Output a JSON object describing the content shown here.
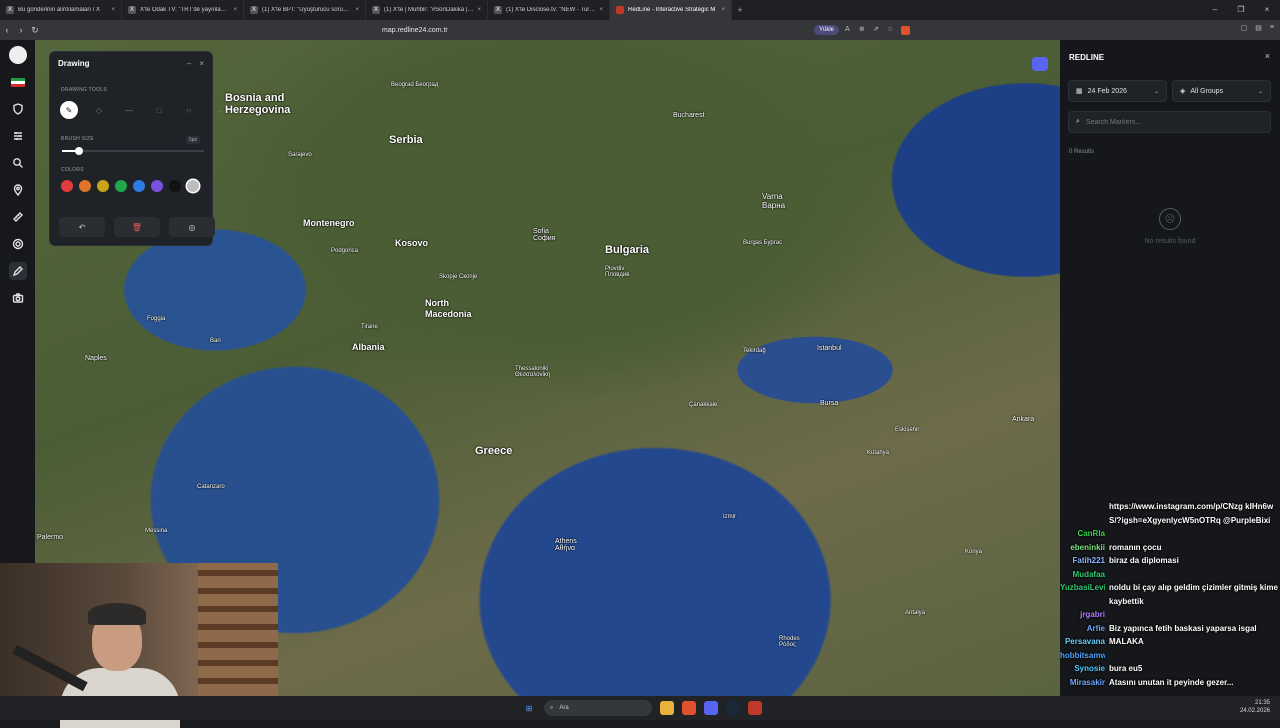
{
  "tabs": [
    {
      "title": "Bu gönderinin alıntılamaları / X",
      "icon": "x-icon",
      "active": false
    },
    {
      "title": "X'te Odak TV: \"TRT'de yayınlanan Bir",
      "icon": "x-icon",
      "active": false
    },
    {
      "title": "(1) X'te BPT: \"Uyuşturucu soruşturmu",
      "icon": "x-icon",
      "active": false
    },
    {
      "title": "(1) X'te | Muhbir: \"#SonDakika | Ur",
      "icon": "x-icon",
      "active": false
    },
    {
      "title": "(1) X'te Disclose.tv: \"NEW - Turkey to",
      "icon": "x-icon",
      "active": false
    },
    {
      "title": "RedLine - Interactive Strategic M",
      "icon": "redline-icon",
      "active": true
    }
  ],
  "address": {
    "url": "map.redline24.com.tr",
    "yukle": "Yükle"
  },
  "drawing": {
    "title": "Drawing",
    "tools_label": "DRAWING TOOLS",
    "brush_label": "BRUSH SIZE",
    "brush_value": "5px",
    "brush_fraction": 0.12,
    "colors_label": "COLORS",
    "colors": [
      "#e23c3c",
      "#e0752a",
      "#c9a41b",
      "#22a64b",
      "#2b7de1",
      "#7b4fe0",
      "#111111",
      "#bdbdbd"
    ]
  },
  "side": {
    "title": "REDLINE",
    "date": "24 Feb 2026",
    "group": "All Groups",
    "search_placeholder": "Search Markers...",
    "results": "0 Results",
    "empty": "No results found"
  },
  "map_labels": [
    {
      "t": "Bosnia and Herzegovina",
      "c": true
    },
    {
      "t": "Serbia",
      "c": true
    },
    {
      "t": "Montenegro",
      "c": true
    },
    {
      "t": "Kosovo",
      "c": true
    },
    {
      "t": "Bulgaria",
      "c": true
    },
    {
      "t": "North Macedonia",
      "c": true
    },
    {
      "t": "Albania",
      "c": true
    },
    {
      "t": "Greece",
      "c": true
    },
    {
      "t": "Sarajevo"
    },
    {
      "t": "Beograd Београд"
    },
    {
      "t": "Bucharest"
    },
    {
      "t": "Sofia София"
    },
    {
      "t": "Varna Варна"
    },
    {
      "t": "Skopje Скопје"
    },
    {
      "t": "Tirane"
    },
    {
      "t": "Thessaloniki Θεσσαλονίκη"
    },
    {
      "t": "Athens Αθήνα"
    },
    {
      "t": "Istanbul"
    },
    {
      "t": "Bursa"
    },
    {
      "t": "Izmir"
    },
    {
      "t": "Ankara"
    },
    {
      "t": "Eskişehir"
    },
    {
      "t": "Konya"
    },
    {
      "t": "Antalya"
    },
    {
      "t": "Naples"
    },
    {
      "t": "Bari"
    },
    {
      "t": "Palermo"
    },
    {
      "t": "Plovdiv Пловдив"
    },
    {
      "t": "Burgas Бургас"
    },
    {
      "t": "Podgorica"
    },
    {
      "t": "Foggia"
    },
    {
      "t": "Catanzaro"
    },
    {
      "t": "Messina"
    },
    {
      "t": "Rhodes Ρόδος"
    },
    {
      "t": "Kütahya"
    },
    {
      "t": "Tekirdağ"
    },
    {
      "t": "Çanakkale"
    }
  ],
  "chat": [
    {
      "name": "",
      "color": "#ffffff",
      "msg": "https://www.instagram.com/p/CNzg kIHn6wS/?igsh=eXgyenlycW5nOTRq @PurpleBixi"
    },
    {
      "name": "CanRla",
      "color": "#39d353",
      "msg": ""
    },
    {
      "name": "ebeninkii",
      "color": "#7ee081",
      "msg": "romanın çocu"
    },
    {
      "name": "Fatih221",
      "color": "#8fb6ff",
      "msg": "biraz da diplomasi"
    },
    {
      "name": "Mudafaa",
      "color": "#2ecc71",
      "msg": ""
    },
    {
      "name": "YuzbasiLevi",
      "color": "#2ecc71",
      "msg": "noldu bi çay alıp geldim çizimler gitmiş kime kaybettik"
    },
    {
      "name": "jrgabri",
      "color": "#b57cff",
      "msg": ""
    },
    {
      "name": "Arfie",
      "color": "#6fa8ff",
      "msg": "Biz yapınca fetih baskasi yaparsa isgal"
    },
    {
      "name": "Persavana",
      "color": "#6ad1ff",
      "msg": "MALAKA"
    },
    {
      "name": "hobbitsamwet",
      "color": "#4fa3ff",
      "msg": ""
    },
    {
      "name": "Synosie",
      "color": "#4ec9ff",
      "msg": "bura eu5"
    },
    {
      "name": "Mirasakir",
      "color": "#6fa8ff",
      "msg": "Atasını unutan it peyinde gezer..."
    }
  ],
  "taskbar": {
    "search": "Ara",
    "time": "21:35",
    "date": "24.02.2026"
  }
}
